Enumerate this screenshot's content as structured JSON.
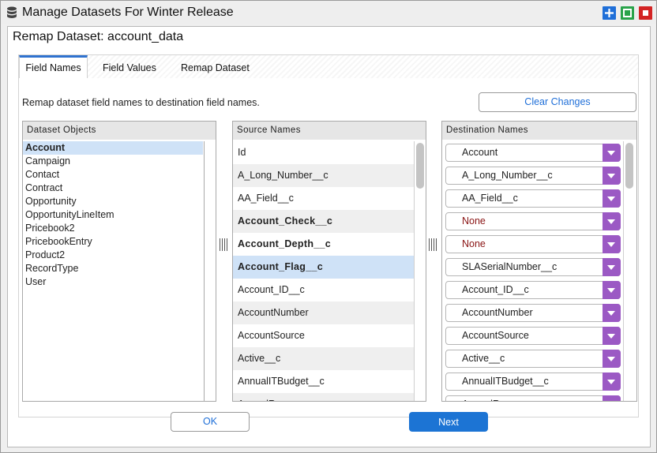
{
  "window": {
    "title": "Manage Datasets For Winter Release"
  },
  "dialog": {
    "title": "Remap Dataset: account_data"
  },
  "tabs": [
    {
      "label": "Field Names",
      "active": true
    },
    {
      "label": "Field Values",
      "active": false
    },
    {
      "label": "Remap Dataset",
      "active": false
    }
  ],
  "instructions": "Remap dataset field names to destination field names.",
  "clear_button": "Clear Changes",
  "dataset_objects": {
    "header": "Dataset Objects",
    "selected": "Account",
    "items": [
      "Account",
      "Campaign",
      "Contact",
      "Contract",
      "Opportunity",
      "OpportunityLineItem",
      "Pricebook2",
      "PricebookEntry",
      "Product2",
      "RecordType",
      "User"
    ]
  },
  "source_names": {
    "header": "Source Names",
    "items": [
      {
        "label": "Id",
        "bold": false,
        "selected": false
      },
      {
        "label": "A_Long_Number__c",
        "bold": false,
        "selected": false
      },
      {
        "label": "AA_Field__c",
        "bold": false,
        "selected": false
      },
      {
        "label": "Account_Check__c",
        "bold": true,
        "selected": false
      },
      {
        "label": "Account_Depth__c",
        "bold": true,
        "selected": false
      },
      {
        "label": "Account_Flag__c",
        "bold": true,
        "selected": true
      },
      {
        "label": "Account_ID__c",
        "bold": false,
        "selected": false
      },
      {
        "label": "AccountNumber",
        "bold": false,
        "selected": false
      },
      {
        "label": "AccountSource",
        "bold": false,
        "selected": false
      },
      {
        "label": "Active__c",
        "bold": false,
        "selected": false
      },
      {
        "label": "AnnualITBudget__c",
        "bold": false,
        "selected": false
      },
      {
        "label": "AnnualRevenue",
        "bold": false,
        "selected": false
      }
    ]
  },
  "destination_names": {
    "header": "Destination Names",
    "items": [
      {
        "value": "Account",
        "none": false
      },
      {
        "value": "A_Long_Number__c",
        "none": false
      },
      {
        "value": "AA_Field__c",
        "none": false
      },
      {
        "value": "None",
        "none": true
      },
      {
        "value": "None",
        "none": true
      },
      {
        "value": "SLASerialNumber__c",
        "none": false
      },
      {
        "value": "Account_ID__c",
        "none": false
      },
      {
        "value": "AccountNumber",
        "none": false
      },
      {
        "value": "AccountSource",
        "none": false
      },
      {
        "value": "Active__c",
        "none": false
      },
      {
        "value": "AnnualITBudget__c",
        "none": false
      },
      {
        "value": "AnnualRevenue",
        "none": false
      }
    ]
  },
  "ok_button": "OK",
  "next_button": "Next",
  "colors": {
    "accent": "#1c74d4",
    "dropdown": "#9b59c4",
    "none_text": "#8a1414",
    "selection": "#cfe2f7"
  },
  "icons": {
    "title": "database-icon",
    "add": "plus-icon",
    "maximize": "square-icon",
    "close": "close-icon"
  }
}
